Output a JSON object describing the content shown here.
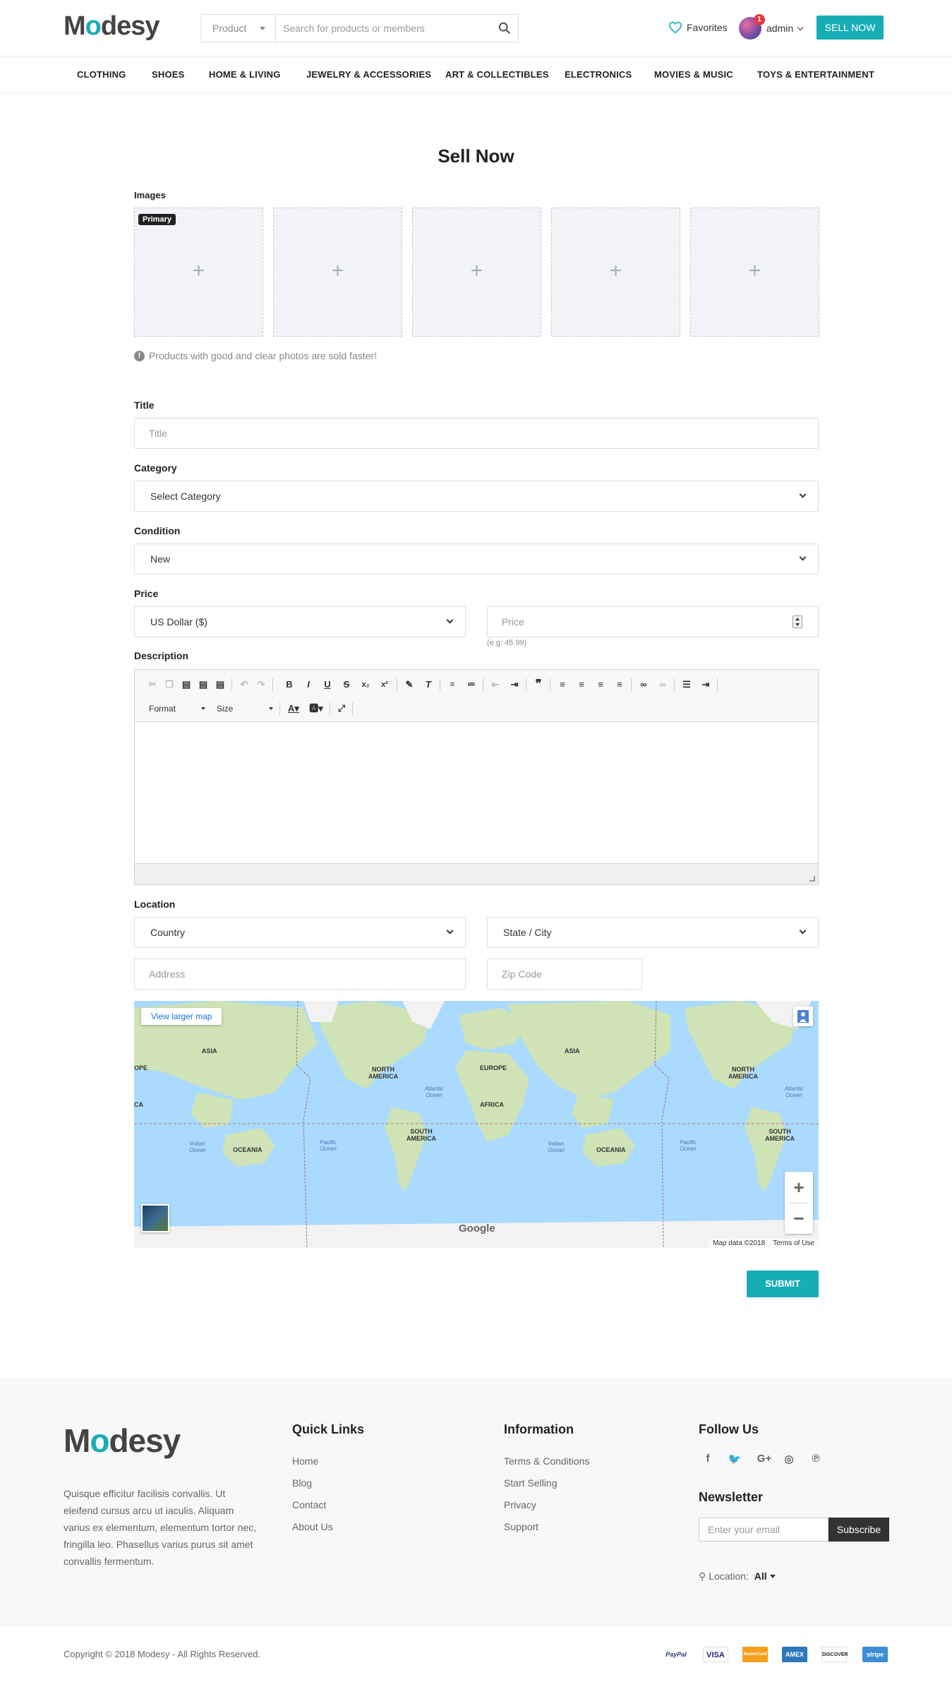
{
  "brand": {
    "logo_prefix": "M",
    "logo_o": "o",
    "logo_suffix": "desy"
  },
  "header": {
    "search_category": "Product",
    "search_placeholder": "Search for products or members",
    "favorites": "Favorites",
    "notification_count": "1",
    "user": "admin",
    "sell_button": "SELL NOW"
  },
  "nav": [
    "CLOTHING",
    "SHOES",
    "HOME & LIVING",
    "JEWELRY & ACCESSORIES",
    "ART & COLLECTIBLES",
    "ELECTRONICS",
    "MOVIES & MUSIC",
    "TOYS & ENTERTAINMENT"
  ],
  "form": {
    "page_title": "Sell Now",
    "images_label": "Images",
    "primary_badge": "Primary",
    "image_slot_symbol": "+",
    "photo_tip": "Products with good and clear photos are sold faster!",
    "title_label": "Title",
    "title_placeholder": "Title",
    "category_label": "Category",
    "category_value": "Select Category",
    "condition_label": "Condition",
    "condition_value": "New",
    "price_label": "Price",
    "currency_value": "US Dollar ($)",
    "price_placeholder": "Price",
    "price_hint": "(e.g: 45.99)",
    "description_label": "Description",
    "editor_format": "Format",
    "editor_size": "Size",
    "location_label": "Location",
    "country_value": "Country",
    "state_value": "State / City",
    "address_placeholder": "Address",
    "zip_placeholder": "Zip Code",
    "submit": "SUBMIT"
  },
  "map": {
    "view_larger": "View larger map",
    "zoom_in": "+",
    "zoom_out": "−",
    "google": "Google",
    "data_credit": "Map data ©2018",
    "terms": "Terms of Use",
    "labels": [
      "ASIA",
      "NORTH AMERICA",
      "EUROPE",
      "ASIA",
      "NORTH AMERICA",
      "AFRICA",
      "SOUTH AMERICA",
      "OCEANIA",
      "OCEANIA",
      "SOUTH AMERICA",
      "OPE",
      "CA"
    ],
    "oceans": [
      "Atlantic Ocean",
      "Indian Ocean",
      "Pacific Ocean",
      "Indian Ocean",
      "Pacific Ocean",
      "Atlantic Ocean"
    ]
  },
  "footer": {
    "description": "Quisque efficitur facilisis convallis. Ut eleifend cursus arcu ut iaculis. Aliquam varius ex elementum, elementum tortor nec, fringilla leo. Phasellus varius purus sit amet convallis fermentum.",
    "quick_links_title": "Quick Links",
    "quick_links": [
      "Home",
      "Blog",
      "Contact",
      "About Us"
    ],
    "information_title": "Information",
    "information_links": [
      "Terms & Conditions",
      "Start Selling",
      "Privacy",
      "Support"
    ],
    "follow_title": "Follow Us",
    "social_icons": [
      "facebook-icon",
      "twitter-icon",
      "google-plus-icon",
      "instagram-icon",
      "pinterest-icon"
    ],
    "newsletter_title": "Newsletter",
    "newsletter_placeholder": "Enter your email",
    "subscribe": "Subscribe",
    "location_label": "Location:",
    "location_value": "All",
    "copyright": "Copyright © 2018 Modesy - All Rights Reserved.",
    "payments": [
      "PayPal",
      "VISA",
      "MasterCard",
      "AMEX",
      "DISCOVER",
      "stripe"
    ]
  },
  "colors": {
    "accent": "#17adb5",
    "dark": "#333333",
    "badge": "#e63946"
  }
}
